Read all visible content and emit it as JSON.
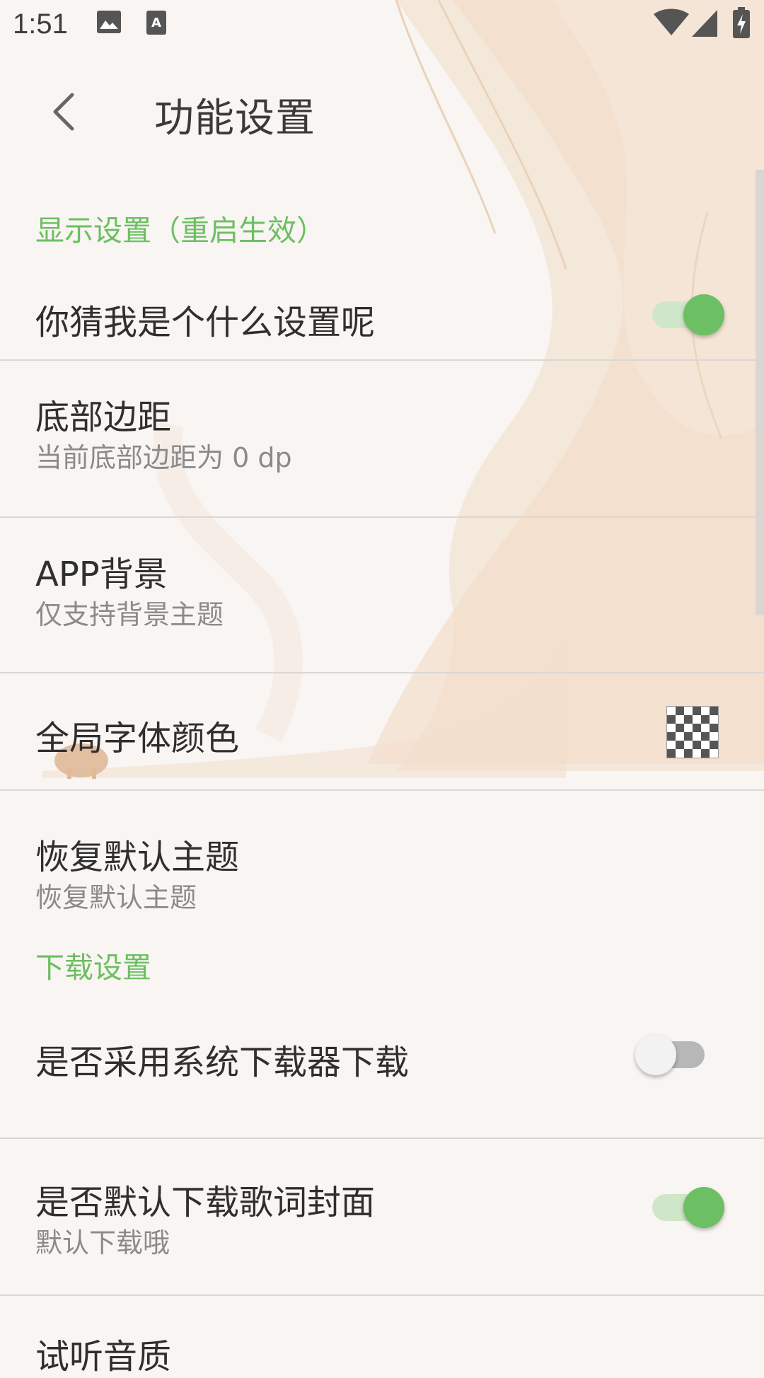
{
  "status_bar": {
    "time": "1:51",
    "icons": [
      "image-icon",
      "font-icon",
      "wifi-icon",
      "signal-icon",
      "battery-charging-icon"
    ]
  },
  "toolbar": {
    "back_icon": "chevron-left-icon",
    "title": "功能设置"
  },
  "sections": [
    {
      "header": "显示设置（重启生效）",
      "items": [
        {
          "title": "你猜我是个什么设置呢",
          "control": "switch",
          "checked": true
        },
        {
          "title": "底部边距",
          "subtitle": "当前底部边距为 0 dp"
        },
        {
          "title": "APP背景",
          "subtitle": "仅支持背景主题"
        },
        {
          "title": "全局字体颜色",
          "control": "color-swatch"
        },
        {
          "title": "恢复默认主题",
          "subtitle": "恢复默认主题"
        }
      ]
    },
    {
      "header": "下载设置",
      "items": [
        {
          "title": "是否采用系统下载器下载",
          "control": "switch",
          "checked": false
        },
        {
          "title": "是否默认下载歌词封面",
          "subtitle": "默认下载哦",
          "control": "switch",
          "checked": true
        },
        {
          "title": "试听音质"
        }
      ]
    }
  ],
  "colors": {
    "accent": "#6cbf62",
    "background": "#f9f5f2",
    "divider": "#dbd7d3"
  }
}
